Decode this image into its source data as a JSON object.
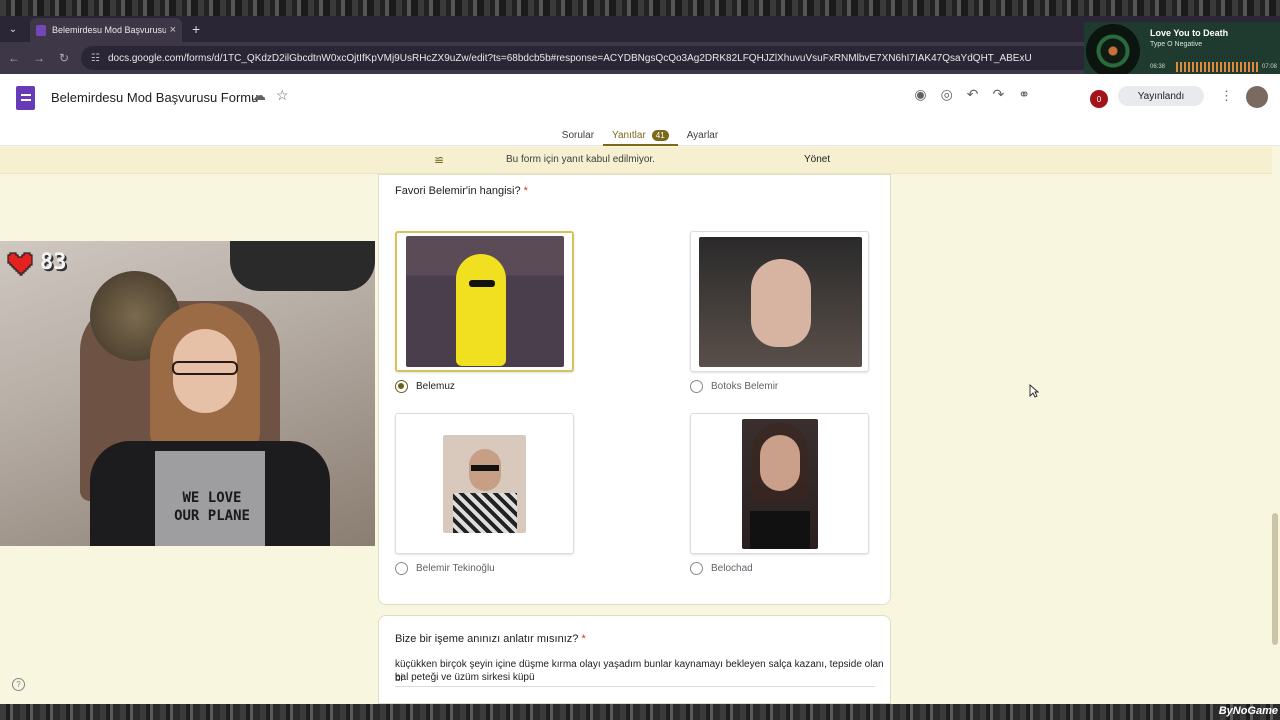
{
  "browser": {
    "tab_title": "Belemirdesu Mod Başvurusu Fo",
    "url": "docs.google.com/forms/d/1TC_QKdzD2ilGbcdtnW0xcOjtIfKpVMj9UsRHcZX9uZw/edit?ts=68bdcb5b#response=ACYDBNgsQcQo3Ag2DRK82LFQHJZlXhuvuVsuFxRNMlbvE7XN6hI7IAK47QsaYdQHT_ABExU",
    "new_tab": "+"
  },
  "form": {
    "title": "Belemirdesu Mod Başvurusu Formu",
    "publish_label": "Yayınlandı",
    "owner_badge": "0",
    "tabs": [
      {
        "label": "Sorular"
      },
      {
        "label": "Yanıtlar",
        "count": "41"
      },
      {
        "label": "Ayarlar"
      }
    ]
  },
  "notice": {
    "text": "Bu form için yanıt kabul edilmiyor.",
    "action": "Yönet"
  },
  "question1": {
    "title": "Favori Belemir'in hangisi?",
    "required_mark": "*",
    "options": [
      {
        "label": "Belemuz",
        "selected": true,
        "image": "banana-costume-image"
      },
      {
        "label": "Botoks Belemir",
        "selected": false,
        "image": "botox-face-image"
      },
      {
        "label": "Belemir Tekinoğlu",
        "selected": false,
        "image": "sunglasses-portrait-image"
      },
      {
        "label": "Belochad",
        "selected": false,
        "image": "dark-hair-portrait-image"
      }
    ]
  },
  "question2": {
    "title": "Bize bir işeme anınızı anlatır mısınız?",
    "required_mark": "*",
    "answer_line1": "küçükken birçok şeyin içine düşme kırma olayı yaşadım bunlar kaynamayı bekleyen salça kazanı, tepside olan bi",
    "answer_line2": "bal peteği ve üzüm sirkesi küpü"
  },
  "webcam": {
    "heart_count": "83",
    "shirt_text_line1": "WE LOVE",
    "shirt_text_line2": "OUR PLANE"
  },
  "music": {
    "song": "Love You to Death",
    "artist": "Type O Negative",
    "elapsed": "06:38",
    "total": "07:08"
  },
  "watermark": "ByNoGame",
  "colors": {
    "page_bg": "#f9f6df",
    "accent": "#6a5f1d",
    "forms_purple": "#673ab7",
    "browser_dark": "#2b2635"
  }
}
